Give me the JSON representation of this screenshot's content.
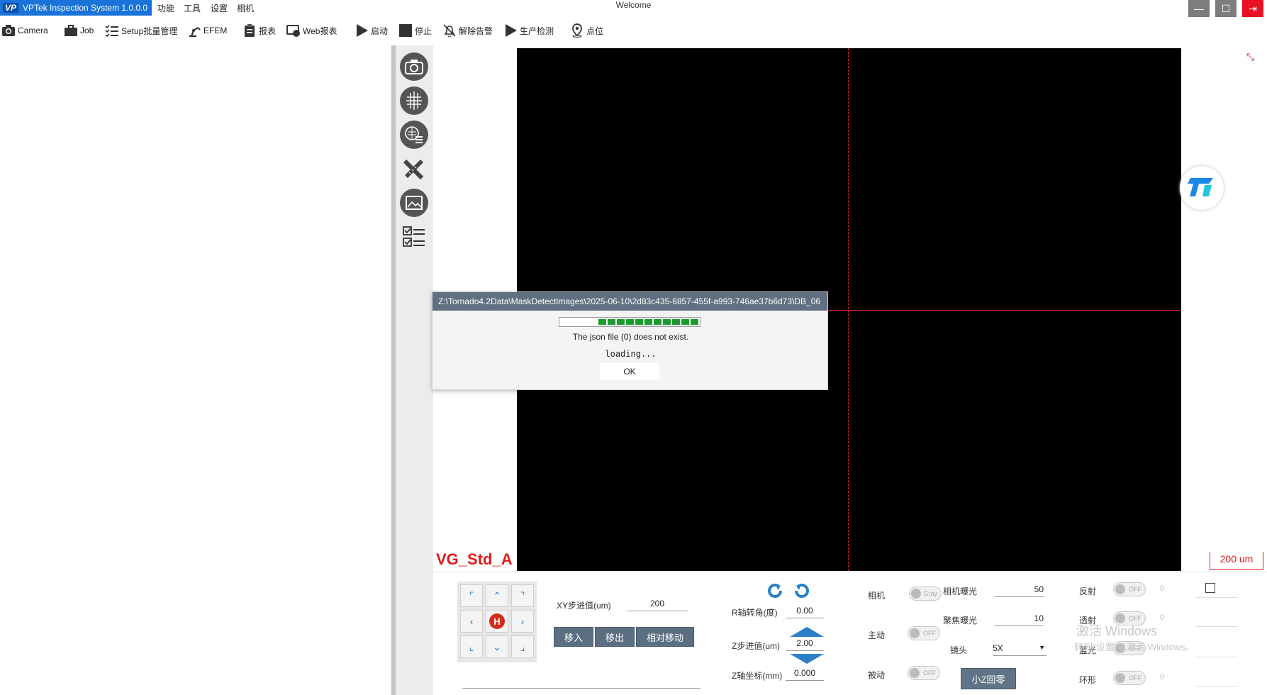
{
  "titlebar": {
    "app_name": "VPTek Inspection System 1.0.0.0",
    "logo": "VP",
    "window_title": "Welcome",
    "menus": [
      "功能",
      "工具",
      "设置",
      "相机"
    ],
    "minimize": "—",
    "maximize": "☐",
    "close": "⇥"
  },
  "toolbar": {
    "items": [
      {
        "label": "Camera",
        "icon": "camera-icon"
      },
      {
        "label": "Job",
        "icon": "briefcase-icon"
      },
      {
        "label": "Setup批量管理",
        "icon": "checklist-icon"
      },
      {
        "label": "EFEM",
        "icon": "robot-arm-icon"
      },
      {
        "label": "报表",
        "icon": "clipboard-icon"
      },
      {
        "label": "Web报表",
        "icon": "web-icon"
      },
      {
        "label": "启动",
        "icon": "play-icon"
      },
      {
        "label": "停止",
        "icon": "stop-icon"
      },
      {
        "label": "解除告警",
        "icon": "bell-off-icon"
      },
      {
        "label": "生产检测",
        "icon": "play-icon"
      },
      {
        "label": "点位",
        "icon": "location-pin-icon"
      }
    ]
  },
  "viewer": {
    "recipe_label": "VG_Std_A",
    "scale_text": "200 um",
    "expand_glyph": "⤡"
  },
  "dialog": {
    "title": "Z:\\Tornado4.2Data\\MaskDetectImages\\2025-06-10\\2d83c435-6857-455f-a993-746ae37b6d73\\DB_06",
    "message": "The json file (0) does not exist.",
    "loading": "loading...",
    "ok": "OK",
    "progress_segments": 11
  },
  "controls": {
    "jog": {
      "home": "H",
      "up": "⌃",
      "down": "⌄",
      "left": "‹",
      "right": "›"
    },
    "xy_step_label": "XY步进值(um)",
    "xy_step_value": "200",
    "move_in": "移入",
    "move_out": "移出",
    "relative_move": "相对移动",
    "r_angle_label": "R轴转角(度)",
    "r_angle_value": "0.00",
    "z_step_label": "Z步进值(um)",
    "z_step_value": "2.00",
    "z_coord_label": "Z轴坐标(mm)",
    "z_coord_value": "0.000",
    "camera_label": "相机",
    "camera_toggle": "Gray",
    "active_label": "主动",
    "active_toggle": "OFF",
    "passive_label": "被动",
    "passive_toggle": "OFF",
    "cam_exposure_label": "相机曝光",
    "cam_exposure_value": "50",
    "focus_exposure_label": "聚焦曝光",
    "focus_exposure_value": "10",
    "lens_label": "镜头",
    "lens_value": "5X",
    "small_z_home": "小Z回零",
    "reflect_label": "反射",
    "reflect_toggle": "OFF",
    "reflect_value": "0",
    "transmit_label": "透射",
    "transmit_toggle": "OFF",
    "transmit_value": "0",
    "blue_label": "蓝光",
    "blue_toggle": "OFF",
    "ring_label": "环形",
    "ring_toggle": "OFF",
    "ring_value": "0"
  },
  "watermark": {
    "line1": "激活 Windows",
    "line2": "转到\"设置\"以激活 Windows。"
  },
  "colors": {
    "accent": "#1a73d9",
    "crosshair": "#e0212f",
    "button": "#5c6f82",
    "progress": "#1a9c2c"
  }
}
